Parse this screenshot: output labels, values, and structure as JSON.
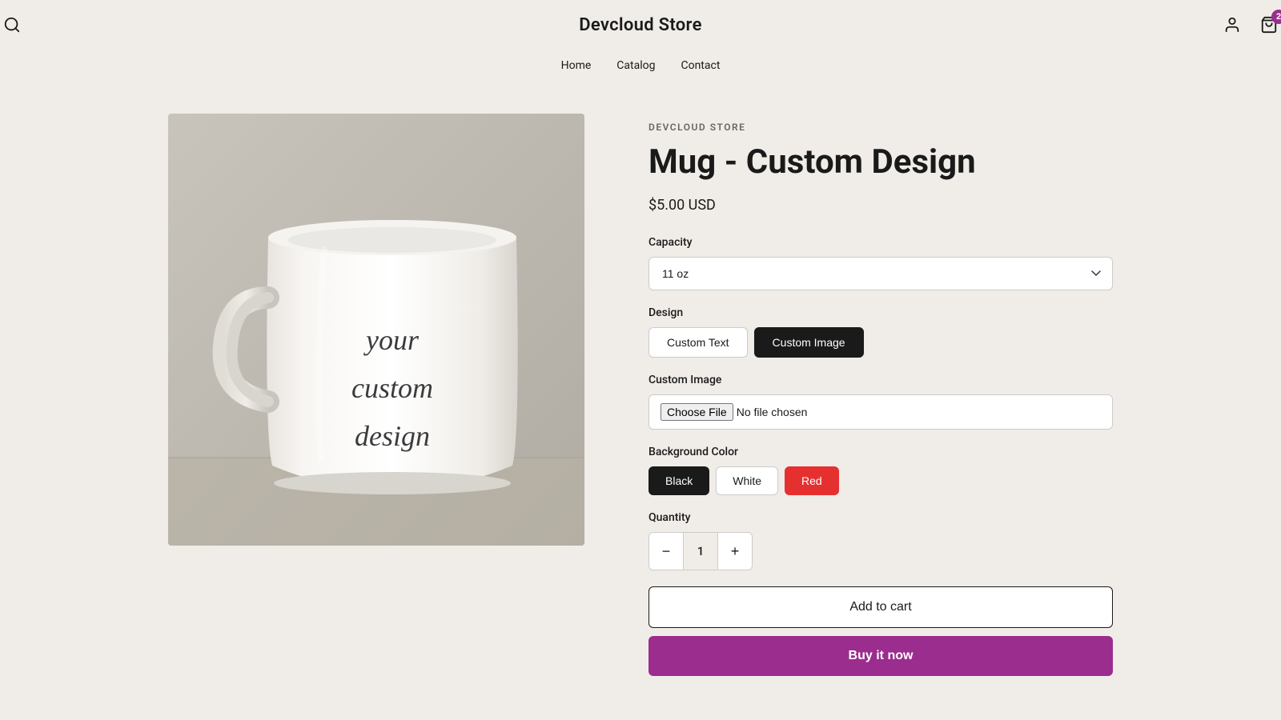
{
  "header": {
    "store_name": "Devcloud Store",
    "nav": {
      "home": "Home",
      "catalog": "Catalog",
      "contact": "Contact"
    },
    "cart_count": "2"
  },
  "product": {
    "store_label": "DEVCLOUD STORE",
    "title": "Mug - Custom Design",
    "price": "$5.00 USD",
    "capacity_label": "Capacity",
    "capacity_value": "11 oz",
    "design_label": "Design",
    "design_options": [
      {
        "id": "custom-text",
        "label": "Custom Text",
        "active": false
      },
      {
        "id": "custom-image",
        "label": "Custom Image",
        "active": true
      }
    ],
    "custom_image_label": "Custom Image",
    "file_placeholder": "No file chosen",
    "choose_file_label": "Choose File",
    "bg_color_label": "Background Color",
    "colors": [
      {
        "id": "black",
        "label": "Black",
        "active": true
      },
      {
        "id": "white",
        "label": "White",
        "active": false
      },
      {
        "id": "red",
        "label": "Red",
        "active": false
      }
    ],
    "quantity_label": "Quantity",
    "quantity_value": "1",
    "add_to_cart": "Add to cart",
    "buy_now": "Buy it now"
  }
}
